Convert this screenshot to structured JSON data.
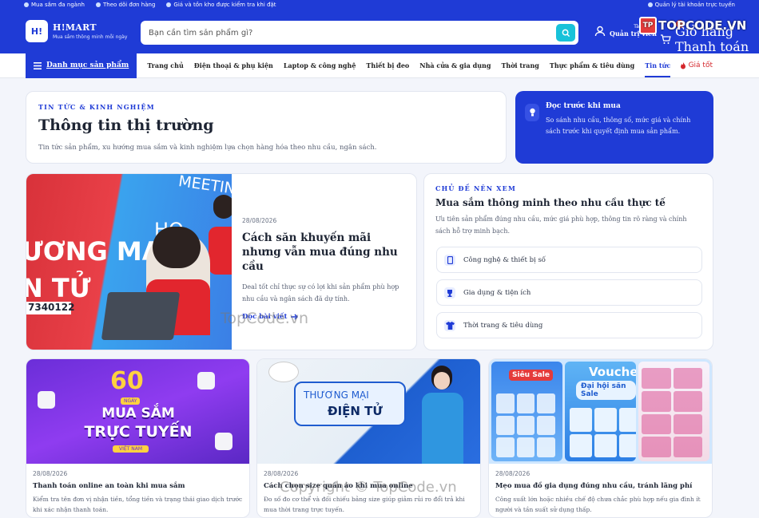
{
  "topbar": {
    "items": [
      "Mua sắm đa ngành",
      "Theo dõi đơn hàng",
      "Giá và tồn kho được kiểm tra khi đặt"
    ],
    "right": "Quản lý tài khoản trực tuyến"
  },
  "header": {
    "logo_mark": "H!",
    "logo_name": "H!MART",
    "logo_tagline": "Mua sắm thông minh mỗi ngày",
    "search_placeholder": "Bạn cần tìm sản phẩm gì?",
    "account_small": "Tài khoản",
    "account_big": "Quản trị viên",
    "cart_small": "Giỏ hàng",
    "cart_big": "Thanh toán",
    "cart_count": "0"
  },
  "watermark": {
    "logo_text": "TOPCODE.VN",
    "logo_mark": "TP",
    "center": "TopCode.vn",
    "copyright": "Copyright © TopCode.vn"
  },
  "nav": {
    "category_label": "Danh mục sản phẩm",
    "links": [
      "Trang chủ",
      "Điện thoại & phụ kiện",
      "Laptop & công nghệ",
      "Thiết bị đeo",
      "Nhà cửa & gia dụng",
      "Thời trang",
      "Thực phẩm & tiêu dùng",
      "Tin tức"
    ],
    "good_price": "Giá tốt"
  },
  "intro": {
    "kicker": "TIN TỨC & KINH NGHIỆM",
    "title": "Thông tin thị trường",
    "desc": "Tin tức sản phẩm, xu hướng mua sắm và kinh nghiệm lựa chọn hàng hóa theo nhu cầu, ngân sách."
  },
  "tip": {
    "title": "Đọc trước khi mua",
    "desc": "So sánh nhu cầu, thông số, mức giá và chính sách trước khi quyết định mua sản phẩm."
  },
  "feature": {
    "image_text": {
      "big1": "ƯƠNG MẠI",
      "big2": "N TỬ",
      "phone": "7340122",
      "meeting": "MEETING",
      "ho": "HO"
    },
    "date": "28/08/2026",
    "title": "Cách săn khuyến mãi nhưng vẫn mua đúng nhu cầu",
    "desc": "Deal tốt chỉ thực sự có lợi khi sản phẩm phù hợp nhu cầu và ngân sách đã dự tính.",
    "read_more": "Đọc bài viết"
  },
  "topics": {
    "kicker": "CHỦ ĐỀ NÊN XEM",
    "title": "Mua sắm thông minh theo nhu cầu thực tế",
    "desc": "Ưu tiên sản phẩm đúng nhu cầu, mức giá phù hợp, thông tin rõ ràng và chính sách hỗ trợ minh bạch.",
    "items": [
      {
        "label": "Công nghệ & thiết bị số",
        "icon": "phone-icon"
      },
      {
        "label": "Gia dụng & tiện ích",
        "icon": "trophy-icon"
      },
      {
        "label": "Thời trang & tiêu dùng",
        "icon": "shirt-icon"
      }
    ]
  },
  "posts": [
    {
      "image_text": {
        "a": "60",
        "b": "NGÀY",
        "c": "MUA SẮM",
        "d": "TRỰC TUYẾN",
        "e": "VIỆT NAM"
      },
      "date": "28/08/2026",
      "title": "Thanh toán online an toàn khi mua sắm",
      "desc": "Kiểm tra tên đơn vị nhận tiền, tổng tiền và trạng thái giao dịch trước khi xác nhận thanh toán."
    },
    {
      "image_text": {
        "a": "THƯƠNG MẠI",
        "b": "ĐIỆN TỬ"
      },
      "date": "28/08/2026",
      "title": "Cách chọn size quần áo khi mua online",
      "desc": "Đo số đo cơ thể và đối chiếu bảng size giúp giảm rủi ro đổi trả khi mua thời trang trực tuyến."
    },
    {
      "image_text": {
        "a": "Siêu Sale",
        "b": "Voucher",
        "c": "Đại hội săn Sale"
      },
      "date": "28/08/2026",
      "title": "Mẹo mua đồ gia dụng đúng nhu cầu, tránh lãng phí",
      "desc": "Công suất lớn hoặc nhiều chế độ chưa chắc phù hợp nếu gia đình ít người và tần suất sử dụng thấp."
    }
  ],
  "colors": {
    "primary": "#1f3bd6",
    "accent": "#18c2d9",
    "sale": "#d4282d"
  }
}
